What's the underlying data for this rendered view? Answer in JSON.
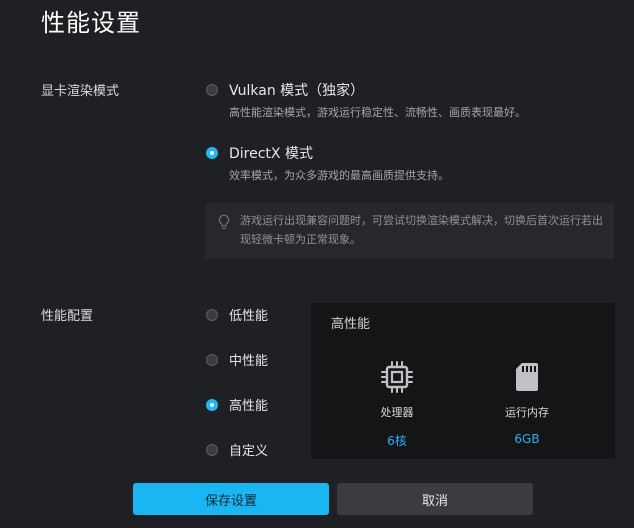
{
  "page": {
    "title": "性能设置"
  },
  "render_mode": {
    "label": "显卡渲染模式",
    "options": [
      {
        "label": "Vulkan 模式（独家）",
        "description": "高性能渲染模式，游戏运行稳定性、流畅性、画质表现最好。",
        "selected": false
      },
      {
        "label": "DirectX 模式",
        "description": "效率模式，为众多游戏的最高画质提供支持。",
        "selected": true
      }
    ],
    "tip": "游戏运行出现兼容问题时，可尝试切换渲染模式解决，切换后首次运行若出现轻微卡顿为正常现象。",
    "tip_icon": "lightbulb-icon"
  },
  "performance": {
    "label": "性能配置",
    "options": [
      {
        "label": "低性能",
        "selected": false
      },
      {
        "label": "中性能",
        "selected": false
      },
      {
        "label": "高性能",
        "selected": true
      },
      {
        "label": "自定义",
        "selected": false
      }
    ],
    "panel": {
      "title": "高性能",
      "cpu": {
        "icon": "processor-chip-icon",
        "label": "处理器",
        "value": "6核"
      },
      "memory": {
        "icon": "memory-card-icon",
        "label": "运行内存",
        "value": "6GB"
      }
    }
  },
  "buttons": {
    "save": "保存设置",
    "cancel": "取消"
  },
  "colors": {
    "accent": "#19b6f3",
    "background": "#1f2023",
    "panel": "#141517"
  }
}
